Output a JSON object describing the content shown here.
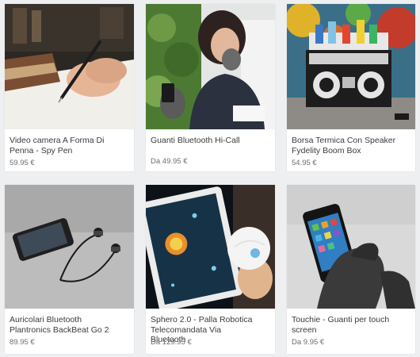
{
  "products": [
    {
      "title_line1": "Video camera A Forma Di",
      "title_line2": "Penna - Spy Pen",
      "title_line3": "",
      "price": "59.95 €"
    },
    {
      "title_line1": "Guanti Bluetooth Hi-Call",
      "title_line2": "",
      "title_line3": "",
      "price": "Da 49.95 €"
    },
    {
      "title_line1": "Borsa Termica Con Speaker",
      "title_line2": "Fydelity Boom Box",
      "title_line3": "",
      "price": "54.95 €"
    },
    {
      "title_line1": "Auricolari Bluetooth",
      "title_line2": "Plantronics BackBeat Go 2",
      "title_line3": "",
      "price": "89.95 €"
    },
    {
      "title_line1": "Sphero 2.0 - Palla Robotica",
      "title_line2": "Telecomandata Via",
      "title_line3": "Bluetooth",
      "price": "Da 129.95 €"
    },
    {
      "title_line1": "Touchie - Guanti per touch",
      "title_line2": "screen",
      "title_line3": "",
      "price": "Da 9.95 €"
    }
  ]
}
